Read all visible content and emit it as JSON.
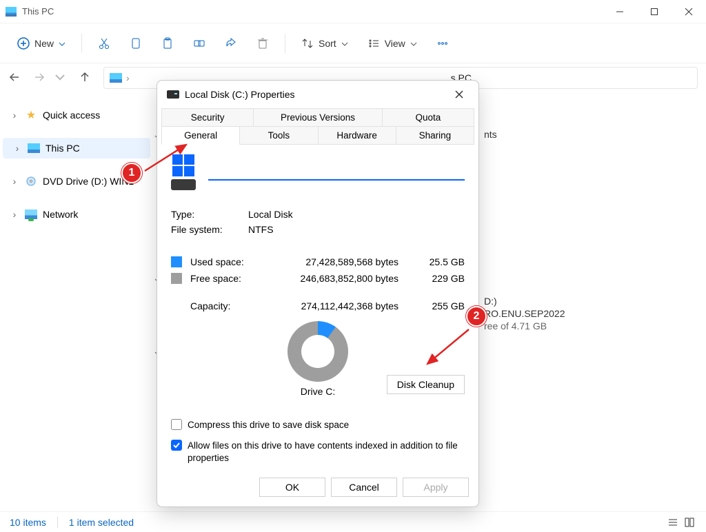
{
  "titlebar": {
    "title": "This PC"
  },
  "toolbar": {
    "new_label": "New",
    "sort_label": "Sort",
    "view_label": "View"
  },
  "address": {
    "location": "s PC"
  },
  "sidebar": {
    "items": [
      {
        "label": "Quick access"
      },
      {
        "label": "This PC"
      },
      {
        "label": "DVD Drive (D:) WIN1"
      },
      {
        "label": "Network"
      }
    ]
  },
  "content": {
    "frag1": "nts",
    "frag2": "D:)",
    "frag3": "RO.ENU.SEP2022",
    "frag4": "ree of 4.71 GB"
  },
  "statusbar": {
    "items": "10 items",
    "selected": "1 item selected"
  },
  "dialog": {
    "title": "Local Disk (C:) Properties",
    "tabs_row1": [
      "Security",
      "Previous Versions",
      "Quota"
    ],
    "tabs_row2": [
      "General",
      "Tools",
      "Hardware",
      "Sharing"
    ],
    "active_tab": "General",
    "type_label": "Type:",
    "type_value": "Local Disk",
    "fs_label": "File system:",
    "fs_value": "NTFS",
    "used_label": "Used space:",
    "used_bytes": "27,428,589,568 bytes",
    "used_human": "25.5 GB",
    "free_label": "Free space:",
    "free_bytes": "246,683,852,800 bytes",
    "free_human": "229 GB",
    "capacity_label": "Capacity:",
    "capacity_bytes": "274,112,442,368 bytes",
    "capacity_human": "255 GB",
    "drive_label": "Drive C:",
    "cleanup_label": "Disk Cleanup",
    "compress_label": "Compress this drive to save disk space",
    "index_label": "Allow files on this drive to have contents indexed in addition to file properties",
    "ok": "OK",
    "cancel": "Cancel",
    "apply": "Apply"
  },
  "annotations": {
    "one": "1",
    "two": "2"
  }
}
